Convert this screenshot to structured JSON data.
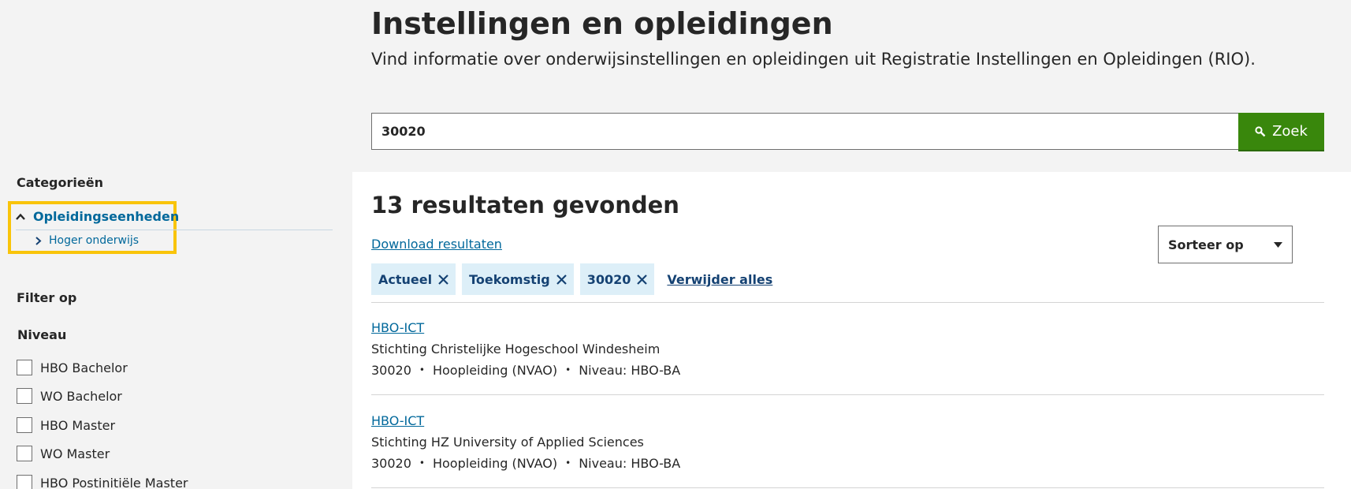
{
  "header": {
    "title": "Instellingen en opleidingen",
    "subtitle": "Vind informatie over onderwijsinstellingen en opleidingen uit Registratie Instellingen en Opleidingen (RIO)."
  },
  "search": {
    "value": "30020",
    "button_label": "Zoek",
    "button_icon": "search-icon",
    "button_color": "#39870c"
  },
  "sidebar": {
    "categories_heading": "Categorieën",
    "categories": [
      {
        "label": "Opleidingseenheden",
        "icon": "chevron-up-icon",
        "expanded": true
      },
      {
        "label": "Hoger onderwijs",
        "icon": "chevron-right-icon"
      }
    ],
    "filter_heading": "Filter op",
    "level_heading": "Niveau",
    "levels": [
      {
        "label": "HBO Bachelor",
        "checked": false
      },
      {
        "label": "WO Bachelor",
        "checked": false
      },
      {
        "label": "HBO Master",
        "checked": false
      },
      {
        "label": "WO Master",
        "checked": false
      },
      {
        "label": "HBO Postinitiële Master",
        "checked": false
      }
    ],
    "highlight_color": "#f9c40a"
  },
  "results": {
    "count_text": "13 resultaten gevonden",
    "download_label": "Download resultaten",
    "sort_label": "Sorteer op",
    "chips": [
      {
        "label": "Actueel",
        "icon": "close-icon"
      },
      {
        "label": "Toekomstig",
        "icon": "close-icon"
      },
      {
        "label": "30020",
        "icon": "close-icon"
      }
    ],
    "remove_all_label": "Verwijder alles",
    "items": [
      {
        "title": "HBO-ICT",
        "organization": "Stichting Christelijke Hogeschool Windesheim",
        "code": "30020",
        "type": "Hoopleiding (NVAO)",
        "level": "Niveau: HBO-BA"
      },
      {
        "title": "HBO-ICT",
        "organization": "Stichting HZ University of Applied Sciences",
        "code": "30020",
        "type": "Hoopleiding (NVAO)",
        "level": "Niveau: HBO-BA"
      }
    ]
  },
  "colors": {
    "link": "#01689b",
    "chip_bg": "#ddeff8",
    "chip_text": "#154273",
    "page_bg": "#f3f3f3"
  }
}
